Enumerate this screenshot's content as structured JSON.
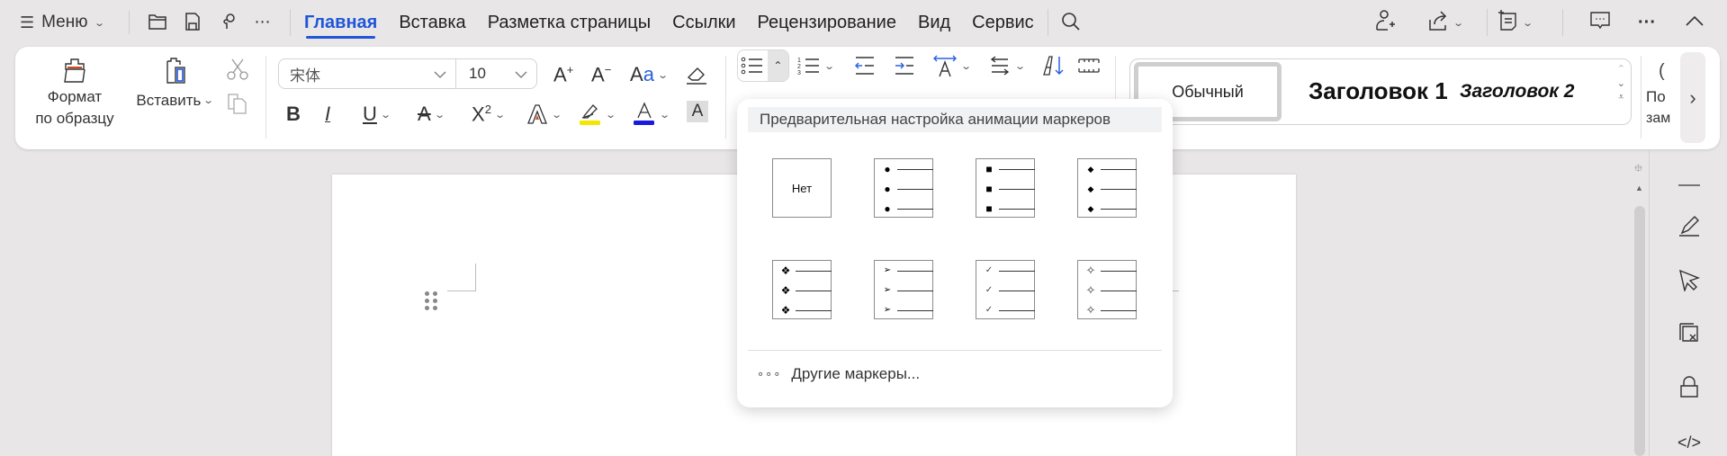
{
  "topbar": {
    "menu_label": "Меню",
    "quick_icons": [
      "folder-icon",
      "save-icon",
      "format-paint-icon",
      "more-icon"
    ],
    "tabs": [
      {
        "label": "Главная",
        "active": true
      },
      {
        "label": "Вставка",
        "active": false
      },
      {
        "label": "Разметка страницы",
        "active": false
      },
      {
        "label": "Ссылки",
        "active": false
      },
      {
        "label": "Рецензирование",
        "active": false
      },
      {
        "label": "Вид",
        "active": false
      },
      {
        "label": "Сервис",
        "active": false
      }
    ],
    "right_icons": [
      "add-user-icon",
      "share-icon",
      "task-icon",
      "comment-icon",
      "more-icon",
      "collapse-icon"
    ],
    "accent_color": "#1f56d8"
  },
  "ribbon": {
    "format_painter_label": "Формат по образцу",
    "format_painter_line1": "Формат",
    "format_painter_line2": "по образцу",
    "paste_label": "Вставить",
    "font_name": "宋体",
    "font_size": "10",
    "highlight_color": "#f5e600",
    "font_color": "#1a1adf",
    "styles": {
      "normal": "Обычный",
      "heading1": "Заголовок 1",
      "heading2": "Заголовок 2"
    },
    "cut_off_button_line1": "По",
    "cut_off_button_line2": "зам"
  },
  "bullets_dropdown": {
    "header": "Предварительная настройка анимации маркеров",
    "options": [
      {
        "name": "none",
        "label": "Нет"
      },
      {
        "name": "filled-circle",
        "glyph": "●"
      },
      {
        "name": "filled-square",
        "glyph": "■"
      },
      {
        "name": "small-diamond",
        "glyph": "◆"
      },
      {
        "name": "ornate-diamond",
        "glyph": "❖"
      },
      {
        "name": "arrowhead",
        "glyph": "➢"
      },
      {
        "name": "checkmark",
        "glyph": "✓"
      },
      {
        "name": "four-point-star",
        "glyph": "✧"
      }
    ],
    "more_label": "Другие маркеры..."
  },
  "right_rail": {
    "icons": [
      "minus-icon",
      "pen-icon",
      "select-pointer-icon",
      "clear-format-icon",
      "lock-icon",
      "code-icon"
    ]
  }
}
